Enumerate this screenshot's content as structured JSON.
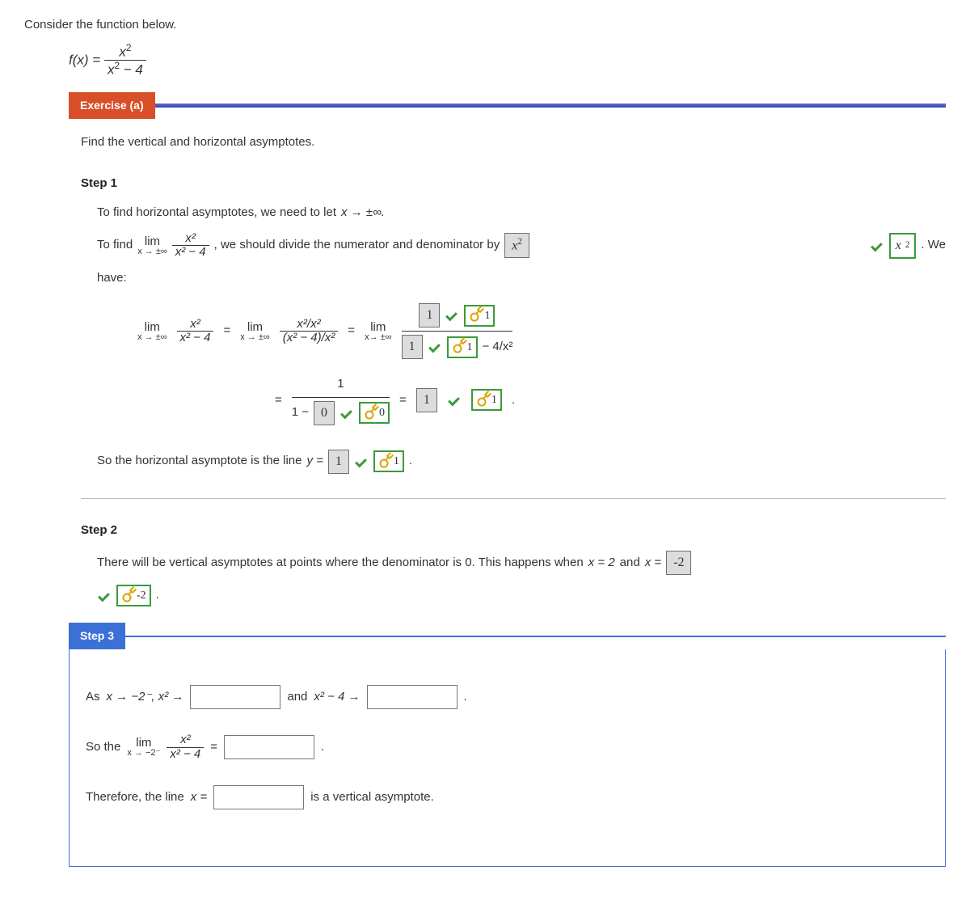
{
  "prompt": "Consider the function below.",
  "function_lhs": "f(x) =",
  "function_numer": "x",
  "function_numer_exp": "2",
  "function_denom_a": "x",
  "function_denom_exp": "2",
  "function_denom_rest": " − 4",
  "exercise_label": "Exercise (a)",
  "exercise_instruction": "Find the vertical and horizontal asymptotes.",
  "step1": {
    "label": "Step 1",
    "line1_a": "To find horizontal asymptotes, we need to let ",
    "line1_b": "x → ±∞.",
    "line2_a": "To find ",
    "line2_b": ", we should divide the numerator and denominator by ",
    "answer_divide": "x",
    "answer_divide_exp": "2",
    "key_divide": "x",
    "key_divide_exp": "2",
    "line2_end": ". We",
    "line3": "have:",
    "eq": {
      "lim_label": "lim",
      "lim_sub": "x → ±∞",
      "lim_sub2": "x→ ±∞",
      "frac1_num": "x²",
      "frac1_den": "x² − 4",
      "frac2_num": "x²/x²",
      "frac2_den": "(x² − 4)/x²",
      "ans_top": "1",
      "key_top": "1",
      "ans_bot": "1",
      "key_bot": "1",
      "bot_tail": " − 4/x²",
      "ans_denom2": "0",
      "key_denom2": "0",
      "ans_final": "1",
      "key_final": "1",
      "row2_prefix": "1 − ",
      "numer_one": "1"
    },
    "concl_a": "So the horizontal asymptote is the line ",
    "concl_b": "y = ",
    "concl_ans": "1",
    "concl_key": "1"
  },
  "step2": {
    "label": "Step 2",
    "text_a": "There will be vertical asymptotes at points where the denominator is 0. This happens when ",
    "text_b": "x = 2",
    "text_c": " and ",
    "text_d": "x = ",
    "ans": "-2",
    "key": "-2"
  },
  "step3": {
    "label": "Step 3",
    "row1_a": "As ",
    "row1_b": "x → −2⁻,  x² →",
    "row1_mid": " and ",
    "row1_c": "x² − 4 →",
    "row2_a": "So the ",
    "row2_lim_sub": "x → −2⁻",
    "row2_frac_num": "x²",
    "row2_frac_den": "x² − 4",
    "row3_a": "Therefore, the line ",
    "row3_b": "x = ",
    "row3_c": " is a vertical asymptote."
  },
  "symbols": {
    "eq": "=",
    "dot": "."
  }
}
